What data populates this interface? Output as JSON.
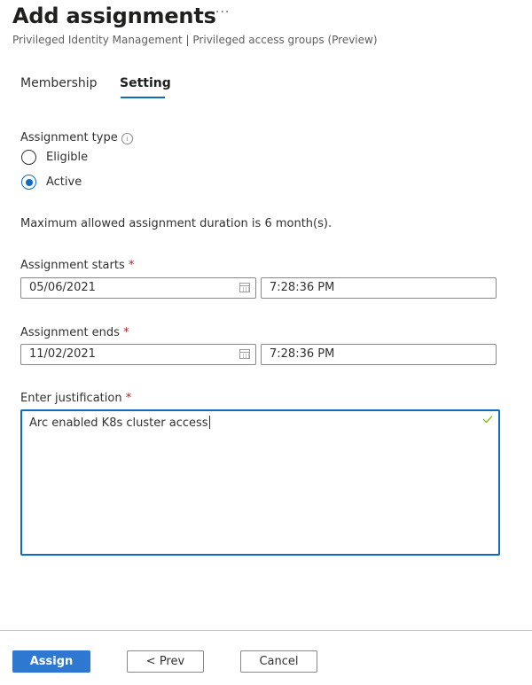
{
  "header": {
    "title": "Add assignments",
    "more_label": "···",
    "subtitle": "Privileged Identity Management | Privileged access groups (Preview)"
  },
  "tabs": [
    {
      "label": "Membership",
      "active": false
    },
    {
      "label": "Setting",
      "active": true
    }
  ],
  "assignment_type": {
    "label": "Assignment type",
    "info_icon": "i",
    "options": [
      {
        "label": "Eligible",
        "checked": false
      },
      {
        "label": "Active",
        "checked": true
      }
    ]
  },
  "duration_notice": "Maximum allowed assignment duration is 6 month(s).",
  "required_marker": "*",
  "assignment_starts": {
    "label": "Assignment starts",
    "date": "05/06/2021",
    "time": "7:28:36 PM"
  },
  "assignment_ends": {
    "label": "Assignment ends",
    "date": "11/02/2021",
    "time": "7:28:36 PM"
  },
  "justification": {
    "label": "Enter justification",
    "value": "Arc enabled K8s cluster access",
    "valid": true
  },
  "footer": {
    "assign_label": "Assign",
    "prev_label": "< Prev",
    "cancel_label": "Cancel"
  },
  "colors": {
    "accent": "#0f6cbd",
    "primary_button": "#2f78d1",
    "required": "#a4262c",
    "valid_check": "#6bb700"
  }
}
